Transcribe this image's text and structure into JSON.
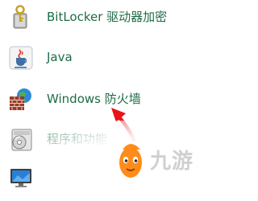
{
  "items": [
    {
      "label": "BitLocker 驱动器加密",
      "icon": "bitlocker-key-icon"
    },
    {
      "label": "Java",
      "icon": "java-cup-icon"
    },
    {
      "label": "Windows 防火墙",
      "icon": "firewall-brick-globe-icon"
    },
    {
      "label": "程序和功能",
      "icon": "programs-disc-icon"
    },
    {
      "label": "",
      "icon": "display-monitor-icon"
    }
  ],
  "annotation": {
    "color": "#e8141c",
    "icon": "red-arrow-icon"
  },
  "watermark": {
    "text": "九游",
    "icon": "mascot-logo-icon"
  },
  "colors": {
    "link": "#1e6c45",
    "background": "#ffffff"
  }
}
